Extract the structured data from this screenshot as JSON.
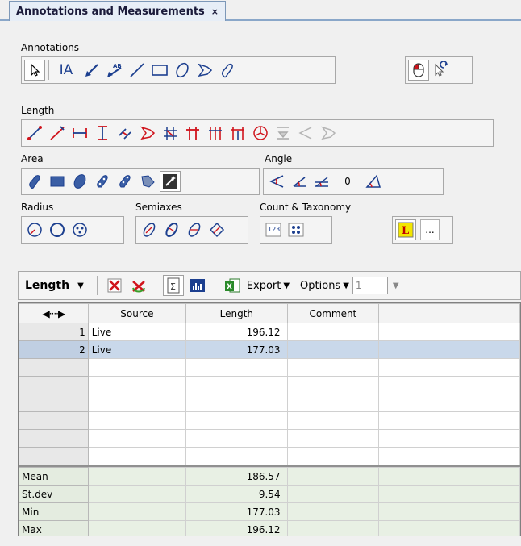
{
  "tab": {
    "title": "Annotations and Measurements",
    "close": "×"
  },
  "sections": {
    "annotations": "Annotations",
    "length": "Length",
    "area": "Area",
    "angle": "Angle",
    "radius": "Radius",
    "semiaxes": "Semiaxes",
    "count_taxonomy": "Count & Taxonomy"
  },
  "annotation_tools": {
    "text_tool": "IA",
    "ab_label": "AB"
  },
  "angle_tools": {
    "zero_label": "0"
  },
  "taxonomy": {
    "more_label": "..."
  },
  "toolbar": {
    "mode_label": "Length",
    "export_label": "Export",
    "options_label": "Options",
    "spin_value": "1"
  },
  "table": {
    "columns": [
      "◀····▶",
      "Source",
      "Length",
      "Comment"
    ],
    "rows": [
      {
        "num": "1",
        "source": "Live",
        "length": "196.12",
        "comment": ""
      },
      {
        "num": "2",
        "source": "Live",
        "length": "177.03",
        "comment": ""
      }
    ],
    "stats": [
      {
        "label": "Mean",
        "value": "186.57"
      },
      {
        "label": "St.dev",
        "value": "9.54"
      },
      {
        "label": "Min",
        "value": "177.03"
      },
      {
        "label": "Max",
        "value": "196.12"
      }
    ]
  },
  "colors": {
    "accent": "#1c3f8f",
    "red": "#d0141c",
    "selection": "#c9d8ea",
    "stats_bg": "#e8f0e4"
  }
}
